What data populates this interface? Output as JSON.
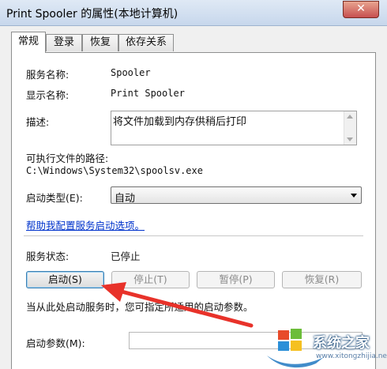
{
  "window": {
    "title": "Print Spooler 的属性(本地计算机)",
    "close_glyph": "✕"
  },
  "tabs": [
    {
      "label": "常规",
      "active": true
    },
    {
      "label": "登录",
      "active": false
    },
    {
      "label": "恢复",
      "active": false
    },
    {
      "label": "依存关系",
      "active": false
    }
  ],
  "general": {
    "service_name_label": "服务名称:",
    "service_name": "Spooler",
    "display_name_label": "显示名称:",
    "display_name": "Print Spooler",
    "description_label": "描述:",
    "description": "将文件加载到内存供稍后打印",
    "exe_path_label": "可执行文件的路径:",
    "exe_path": "C:\\Windows\\System32\\spoolsv.exe",
    "startup_type_label": "启动类型(E):",
    "startup_type": "自动",
    "help_link": "帮助我配置服务启动选项。",
    "status_label": "服务状态:",
    "status": "已停止",
    "buttons": {
      "start": "启动(S)",
      "stop": "停止(T)",
      "pause": "暂停(P)",
      "resume": "恢复(R)"
    },
    "start_hint": "当从此处启动服务时，您可指定所适用的启动参数。",
    "start_params_label": "启动参数(M):",
    "start_params_value": ""
  },
  "annotation": {
    "arrow_color": "#e8322a"
  },
  "watermark": {
    "text": "系统之家",
    "url": "www.xitongzhijia.net"
  }
}
